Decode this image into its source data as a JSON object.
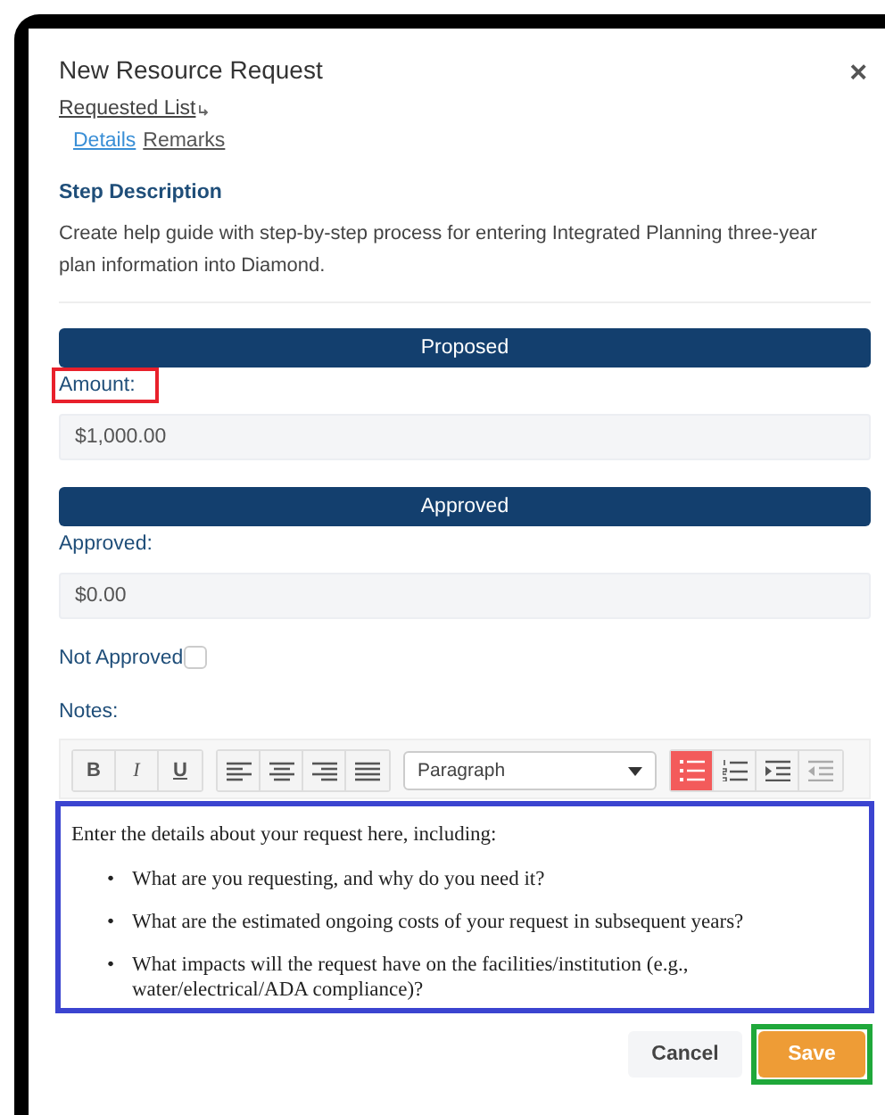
{
  "dialog": {
    "title": "New Resource Request",
    "close": "×"
  },
  "breadcrumb": {
    "label": "Requested List"
  },
  "tabs": [
    {
      "label": "Details",
      "selected": true
    },
    {
      "label": "Remarks",
      "selected": false
    }
  ],
  "step": {
    "heading": "Step Description",
    "text": "Create help guide with step-by-step process for entering Integrated Planning three-year plan information into Diamond."
  },
  "sections": [
    {
      "banner": "Proposed",
      "label": "Amount:",
      "value": "$1,000.00",
      "highlighted": true
    },
    {
      "banner": "Approved",
      "label": "Approved:",
      "value": "$0.00",
      "highlighted": false
    }
  ],
  "not_approved": {
    "label": "Not Approved",
    "checked": false
  },
  "notes": {
    "label": "Notes:",
    "toolbar_groups": [
      {
        "buttons": [
          {
            "kind": "bold",
            "label": "B"
          },
          {
            "kind": "italic",
            "label": "I"
          },
          {
            "kind": "underline",
            "label": "U"
          }
        ]
      },
      {
        "buttons": [
          {
            "kind": "left"
          },
          {
            "kind": "center"
          },
          {
            "kind": "right"
          },
          {
            "kind": "justify"
          }
        ]
      },
      {
        "select": "Paragraph"
      },
      {
        "buttons": [
          {
            "kind": "bullets",
            "active": true
          },
          {
            "kind": "numbers",
            "active": false
          },
          {
            "kind": "indent",
            "active": false
          },
          {
            "kind": "outdent",
            "active": false,
            "disabled": true
          }
        ]
      }
    ],
    "editor": {
      "highlighted": true,
      "intro": "Enter the details about your request here, including:",
      "bullets": [
        {
          "marker": "•",
          "text": "What are you requesting, and why do you need it?"
        },
        {
          "marker": "•",
          "text": "What are the estimated ongoing costs of your request in subsequent years?"
        },
        {
          "marker": "•",
          "text": "What impacts will the request have on the facilities/institution (e.g., water/electrical/ADA compliance)?"
        }
      ]
    }
  },
  "buttons": [
    {
      "kind": "secondary",
      "label": "Cancel",
      "highlighted": false
    },
    {
      "kind": "primary",
      "label": "Save",
      "highlighted": true
    }
  ]
}
